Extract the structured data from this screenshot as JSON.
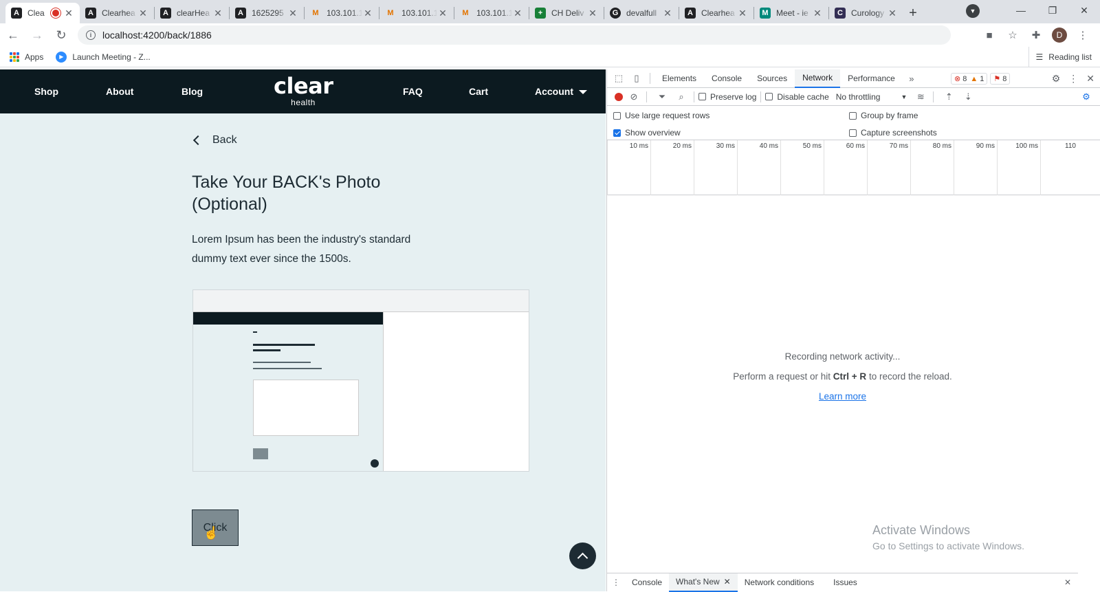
{
  "browser": {
    "tabs": [
      {
        "label": "Clea",
        "favicon": "A",
        "active": true
      },
      {
        "label": "Clearhea",
        "favicon": "A"
      },
      {
        "label": "clearHea",
        "favicon": "A"
      },
      {
        "label": "1625295",
        "favicon": "A"
      },
      {
        "label": "103.101.1",
        "favicon": "M"
      },
      {
        "label": "103.101.1",
        "favicon": "M"
      },
      {
        "label": "103.101.1",
        "favicon": "M"
      },
      {
        "label": "CH Deliv",
        "favicon": "+"
      },
      {
        "label": "devalfull",
        "favicon": "G"
      },
      {
        "label": "Clearhea",
        "favicon": "A"
      },
      {
        "label": "Meet - ie",
        "favicon": "M"
      },
      {
        "label": "Curology",
        "favicon": "C"
      }
    ],
    "url": "localhost:4200/back/1886",
    "avatar_letter": "D",
    "bookmarks": {
      "apps": "Apps",
      "launch_meeting": "Launch Meeting - Z...",
      "reading_list": "Reading list"
    }
  },
  "site": {
    "nav": {
      "shop": "Shop",
      "about": "About",
      "blog": "Blog",
      "logo_main": "clear",
      "logo_sub": "health",
      "faq": "FAQ",
      "cart": "Cart",
      "account": "Account"
    },
    "back_label": "Back",
    "title": "Take Your BACK's Photo (Optional)",
    "description": "Lorem Ipsum has been the industry's standard dummy text ever since the 1500s.",
    "click_label": "Click"
  },
  "devtools": {
    "tabs": [
      "Elements",
      "Console",
      "Sources",
      "Network",
      "Performance"
    ],
    "active_tab": "Network",
    "errors": "8",
    "warnings": "1",
    "issues": "8",
    "preserve_log": "Preserve log",
    "disable_cache": "Disable cache",
    "throttling": "No throttling",
    "use_large_rows": "Use large request rows",
    "show_overview": "Show overview",
    "group_by_frame": "Group by frame",
    "capture_screenshots": "Capture screenshots",
    "ticks": [
      "10 ms",
      "20 ms",
      "30 ms",
      "40 ms",
      "50 ms",
      "60 ms",
      "70 ms",
      "80 ms",
      "90 ms",
      "100 ms",
      "110"
    ],
    "empty_line1": "Recording network activity...",
    "empty_line2_pre": "Perform a request or hit ",
    "empty_line2_key": "Ctrl + R",
    "empty_line2_post": " to record the reload.",
    "learn_more": "Learn more",
    "drawer_tabs": [
      "Console",
      "What's New",
      "Network conditions",
      "Issues"
    ],
    "drawer_active": "What's New"
  },
  "watermark": {
    "title": "Activate Windows",
    "subtitle": "Go to Settings to activate Windows."
  },
  "colors": {
    "site_nav_bg": "#0c1a20",
    "page_bg": "#e6f0f2",
    "accent": "#1a73e8",
    "record_red": "#d93025"
  }
}
